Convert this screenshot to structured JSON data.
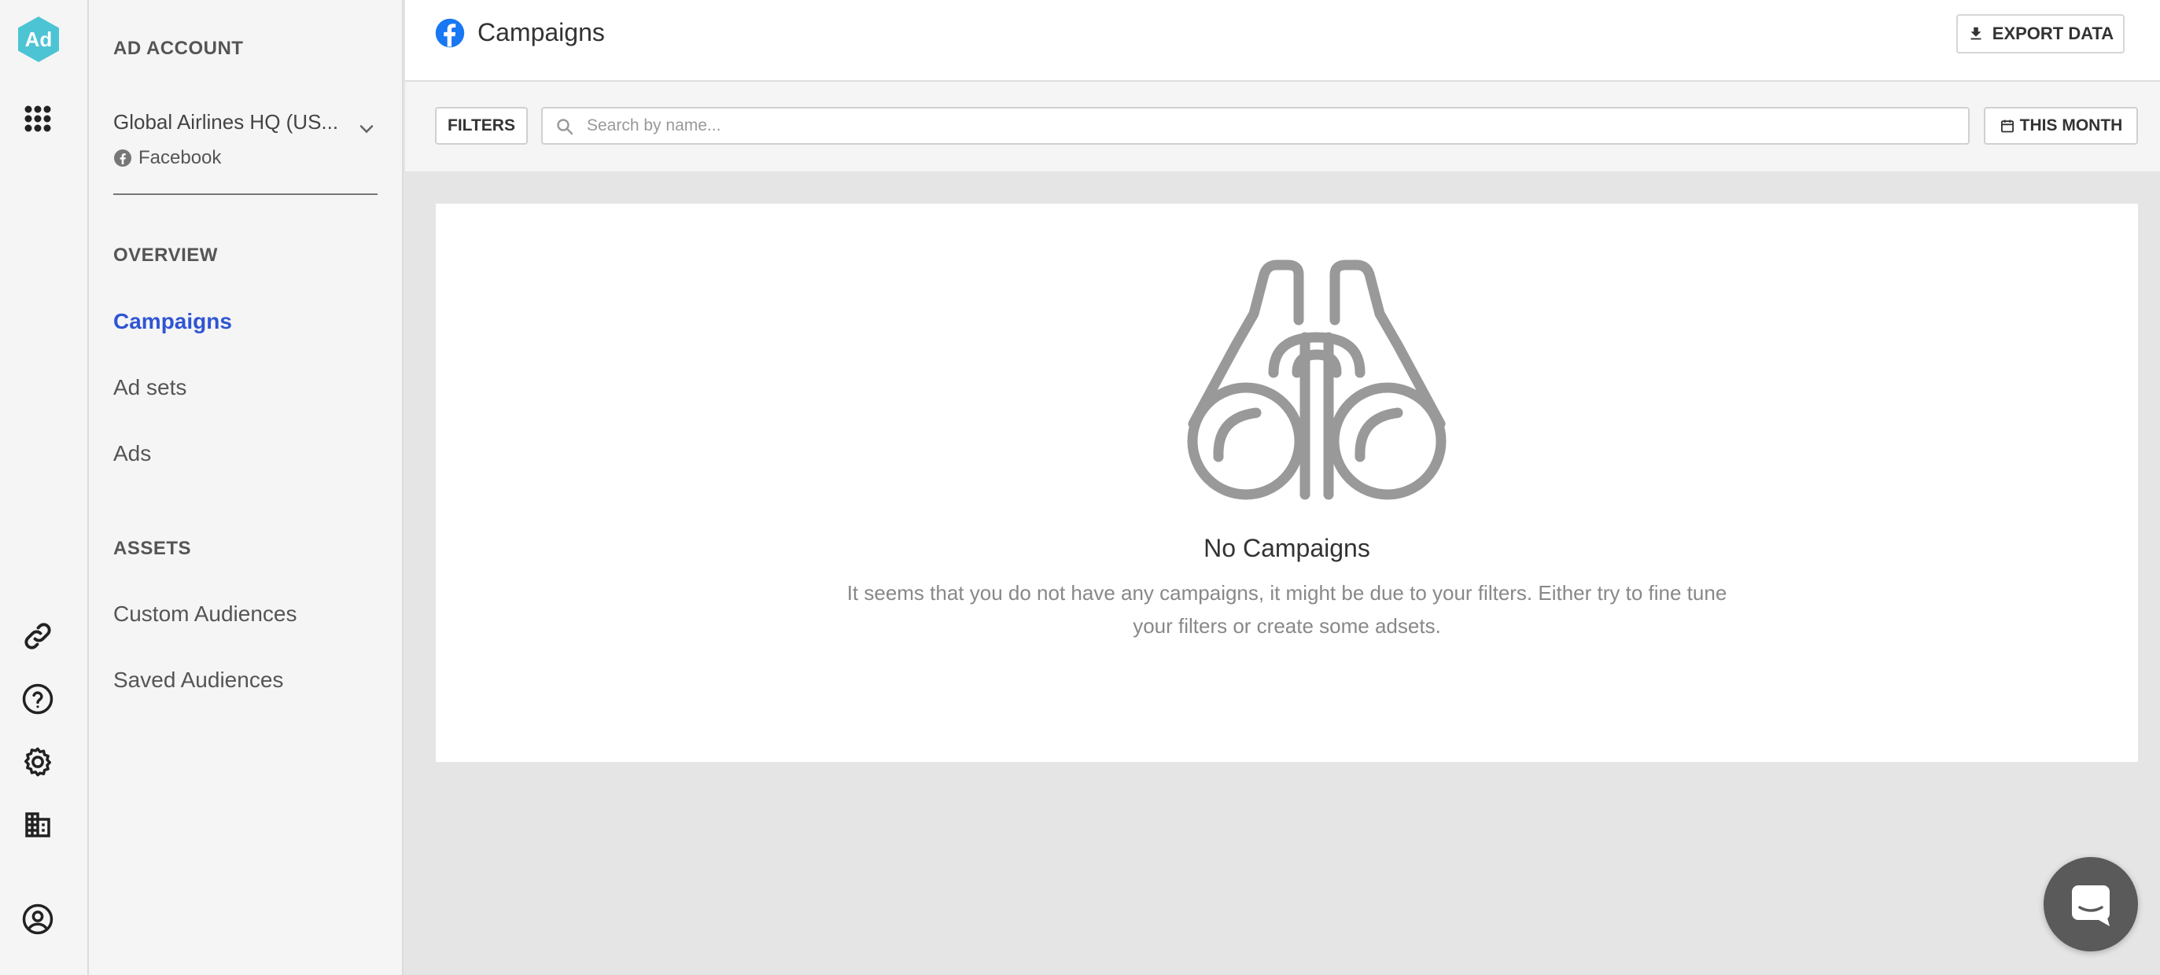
{
  "rail": {
    "logo_text": "Ad",
    "logo_color": "#4cc4d4",
    "icons": [
      "apps-grid-icon",
      "link-icon",
      "help-icon",
      "gear-icon",
      "building-icon",
      "account-circle-icon"
    ]
  },
  "nav": {
    "ad_account_heading": "AD ACCOUNT",
    "account_name": "Global Airlines HQ (US...",
    "account_platform": "Facebook",
    "overview_heading": "OVERVIEW",
    "overview_items": [
      {
        "label": "Campaigns",
        "active": true
      },
      {
        "label": "Ad sets",
        "active": false
      },
      {
        "label": "Ads",
        "active": false
      }
    ],
    "assets_heading": "ASSETS",
    "assets_items": [
      {
        "label": "Custom Audiences"
      },
      {
        "label": "Saved Audiences"
      }
    ]
  },
  "header": {
    "title": "Campaigns",
    "export_label": "EXPORT DATA"
  },
  "toolbar": {
    "filters_label": "FILTERS",
    "search_placeholder": "Search by name...",
    "search_value": "",
    "date_range_label": "THIS MONTH"
  },
  "empty_state": {
    "title": "No Campaigns",
    "description": "It seems that you do not have any campaigns, it might be due to your filters. Either try to fine tune your filters or create some adsets."
  },
  "colors": {
    "accent": "#2f55d4",
    "facebook": "#1877f2",
    "logo": "#4cc4d4"
  }
}
